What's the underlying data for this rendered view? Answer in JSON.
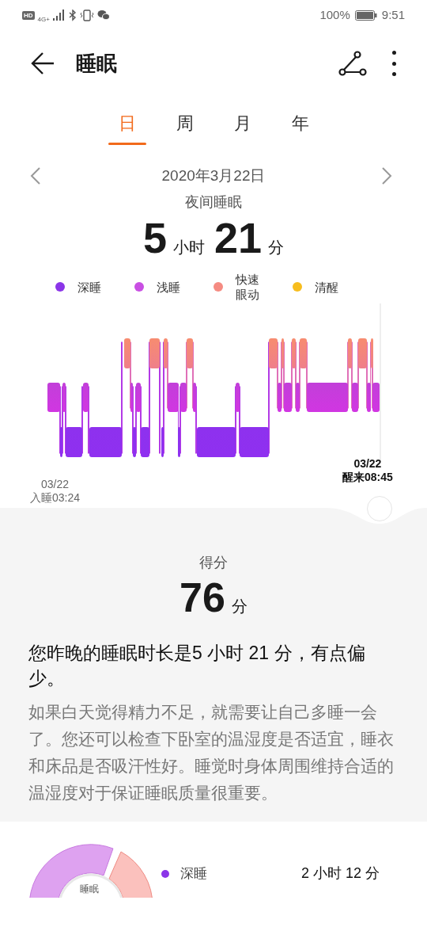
{
  "status_bar": {
    "hd": "HD",
    "network": "4G+",
    "battery": "100%",
    "time": "9:51"
  },
  "header": {
    "title": "睡眠"
  },
  "tabs": [
    {
      "label": "日",
      "selected": true
    },
    {
      "label": "周",
      "selected": false
    },
    {
      "label": "月",
      "selected": false
    },
    {
      "label": "年",
      "selected": false
    }
  ],
  "date_nav": {
    "date": "2020年3月22日"
  },
  "summary": {
    "label": "夜间睡眠",
    "hours": "5",
    "hours_unit": "小时",
    "minutes": "21",
    "minutes_unit": "分"
  },
  "legend": [
    {
      "label": "深睡",
      "color": "#8b35e8"
    },
    {
      "label": "浅睡",
      "color": "#c94fe3"
    },
    {
      "label": "快速眼动",
      "color": "#f58b82"
    },
    {
      "label": "清醒",
      "color": "#f7bd1e"
    }
  ],
  "chart": {
    "start_date": "03/22",
    "start_label": "入睡03:24",
    "end_date": "03/22",
    "end_label": "醒来08:45"
  },
  "score": {
    "label": "得分",
    "value": "76",
    "unit": "分"
  },
  "advice": {
    "title": "您昨晚的睡眠时长是5 小时 21 分，有点偏少。",
    "body": "如果白天觉得精力不足，就需要让自己多睡一会了。您还可以检查下卧室的温湿度是否适宜，睡衣和床品是否吸汗性好。睡觉时身体周围维持合适的温湿度对于保证睡眠质量很重要。"
  },
  "breakdown": {
    "donut_label": "睡眠",
    "rows": [
      {
        "label": "深睡",
        "color": "#8b35e8",
        "duration": "2 小时 12 分"
      }
    ]
  }
}
